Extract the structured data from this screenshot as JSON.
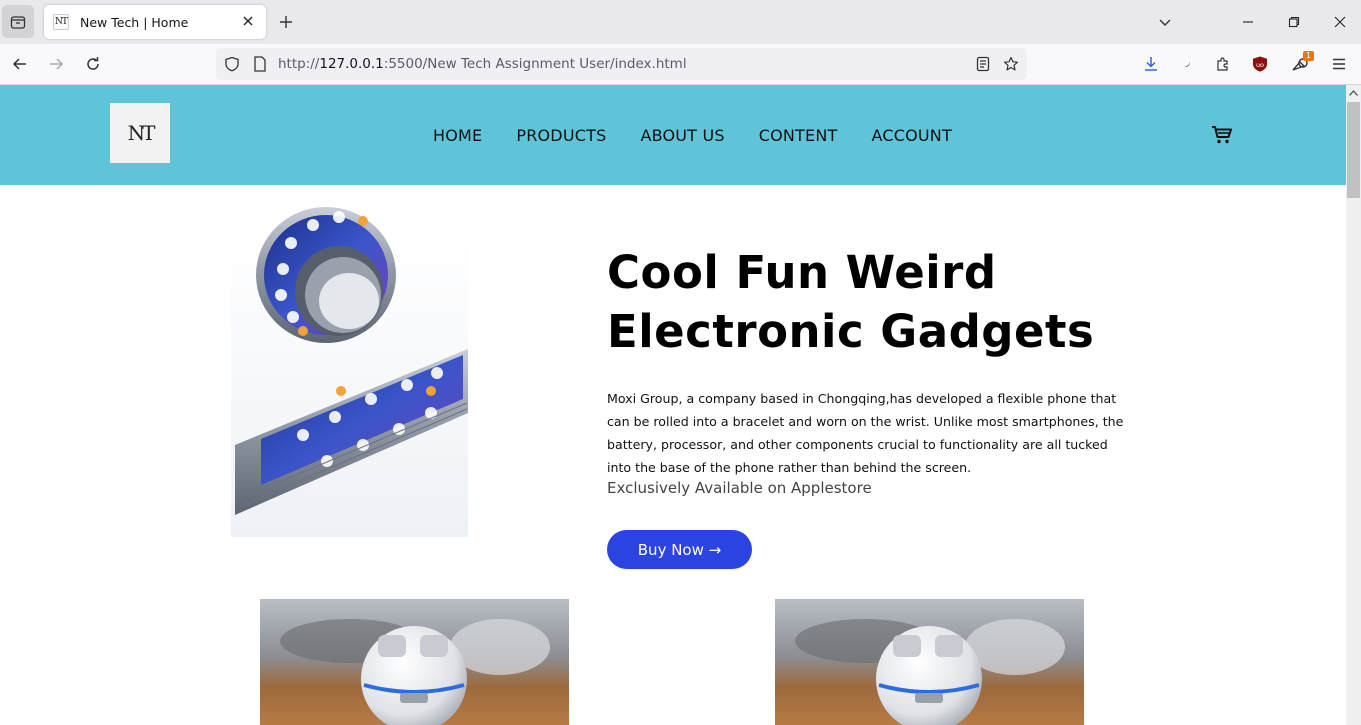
{
  "browser": {
    "tab_title": "New Tech | Home",
    "favicon_text": "NT",
    "url_prefix": "http://",
    "url_host": "127.0.0.1",
    "url_rest": ":5500/New Tech Assignment User/index.html",
    "extension_badge": "1"
  },
  "site": {
    "logo_text": "NT",
    "nav": [
      "HOME",
      "PRODUCTS",
      "ABOUT US",
      "CONTENT",
      "ACCOUNT"
    ],
    "hero": {
      "headline_line1": "Cool Fun Weird",
      "headline_line2": "Electronic Gadgets",
      "description": "Moxi Group, a company based in Chongqing,has developed a flexible phone that can be rolled into a bracelet and worn on the wrist. Unlike most smartphones, the battery, processor, and other components crucial to functionality are all tucked into the base of the phone rather than behind the screen.",
      "exclusive": "Exclusively Available on Applestore",
      "cta": "Buy Now →"
    }
  },
  "colors": {
    "header_bg": "#5fc4d8",
    "cta_bg": "#2b43e0",
    "ublock_red": "#8b0f0f",
    "download_blue": "#2f6ad0"
  }
}
